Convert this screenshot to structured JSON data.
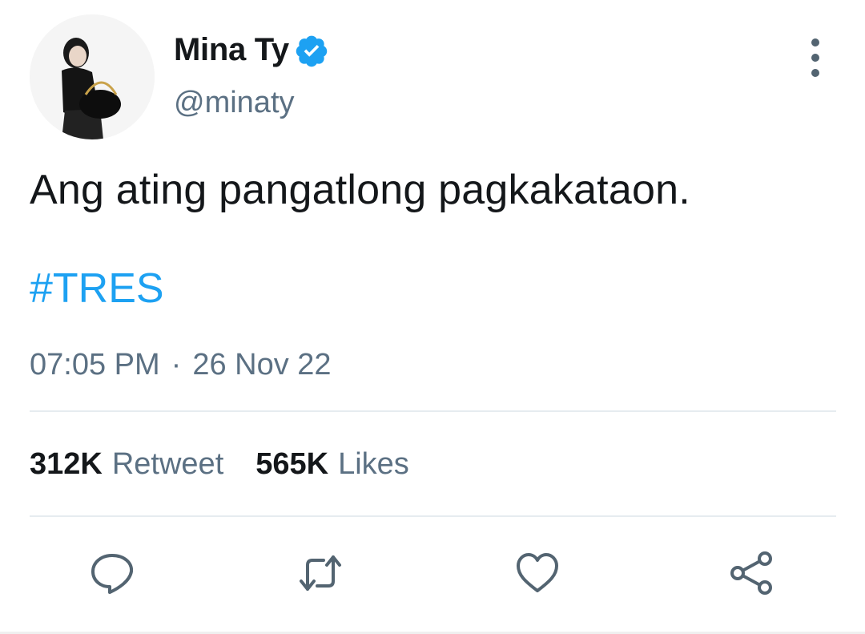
{
  "author": {
    "display_name": "Mina Ty",
    "handle": "@minaty",
    "verified": true,
    "avatar": "profile-photo"
  },
  "tweet": {
    "text": "Ang ating pangatlong pagkakataon.",
    "hashtag": "#TRES",
    "time": "07:05 PM",
    "separator": "·",
    "date": "26 Nov 22"
  },
  "stats": {
    "retweets_count": "312K",
    "retweets_label": "Retweet",
    "likes_count": "565K",
    "likes_label": "Likes"
  },
  "actions": [
    "reply-icon",
    "retweet-icon",
    "like-icon",
    "share-icon"
  ],
  "colors": {
    "accent": "#1da1f2",
    "secondary_text": "#5b7083",
    "primary_text": "#14171a",
    "divider": "#e6ecf0"
  }
}
